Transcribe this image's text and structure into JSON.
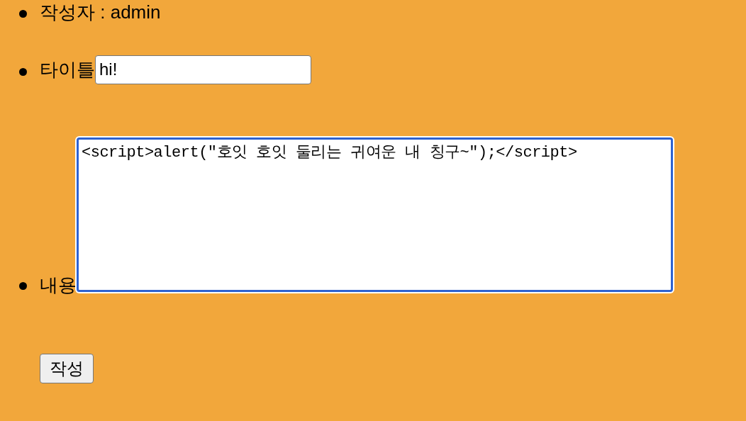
{
  "author": {
    "text": "작성자 : admin"
  },
  "title_field": {
    "label": "타이틀",
    "value": "hi!"
  },
  "content_field": {
    "label": "내용",
    "value": "<script>alert(\"호잇 호잇 둘리는 귀여운 내 칭구~\");</script>",
    "focused": true
  },
  "submit_button": {
    "label": "작성"
  }
}
